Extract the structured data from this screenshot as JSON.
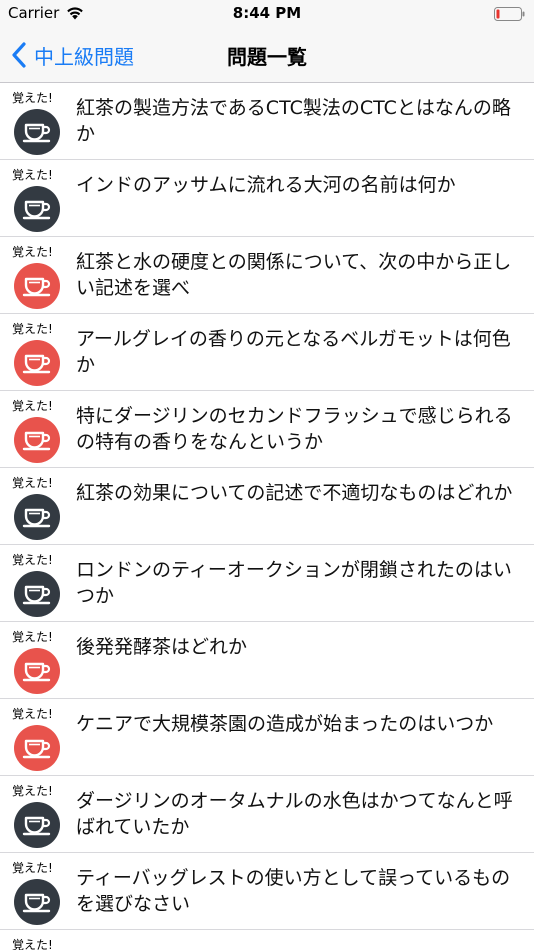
{
  "status_bar": {
    "carrier": "Carrier",
    "time": "8:44 PM",
    "wifi_icon": "wifi-icon",
    "battery_icon": "battery-icon"
  },
  "nav": {
    "back_label": "中上級問題",
    "back_icon": "chevron-left-icon",
    "title": "問題一覧"
  },
  "colors": {
    "accent": "#1a7cf5",
    "dark_badge": "#333a42",
    "red_badge": "#e8534c"
  },
  "memo_label": "覚えた!",
  "questions": [
    {
      "text": "紅茶の製造方法であるCTC製法のCTCとはなんの略か",
      "state": "dark"
    },
    {
      "text": "インドのアッサムに流れる大河の名前は何か",
      "state": "dark"
    },
    {
      "text": "紅茶と水の硬度との関係について、次の中から正しい記述を選べ",
      "state": "red"
    },
    {
      "text": "アールグレイの香りの元となるベルガモットは何色か",
      "state": "red"
    },
    {
      "text": "特にダージリンのセカンドフラッシュで感じられるの特有の香りをなんというか",
      "state": "red"
    },
    {
      "text": "紅茶の効果についての記述で不適切なものはどれか",
      "state": "dark"
    },
    {
      "text": "ロンドンのティーオークションが閉鎖されたのはいつか",
      "state": "dark"
    },
    {
      "text": "後発発酵茶はどれか",
      "state": "red"
    },
    {
      "text": "ケニアで大規模茶園の造成が始まったのはいつか",
      "state": "red"
    },
    {
      "text": "ダージリンのオータムナルの水色はかつてなんと呼ばれていたか",
      "state": "dark"
    },
    {
      "text": "ティーバッグレストの使い方として誤っているものを選びなさい",
      "state": "dark"
    }
  ]
}
